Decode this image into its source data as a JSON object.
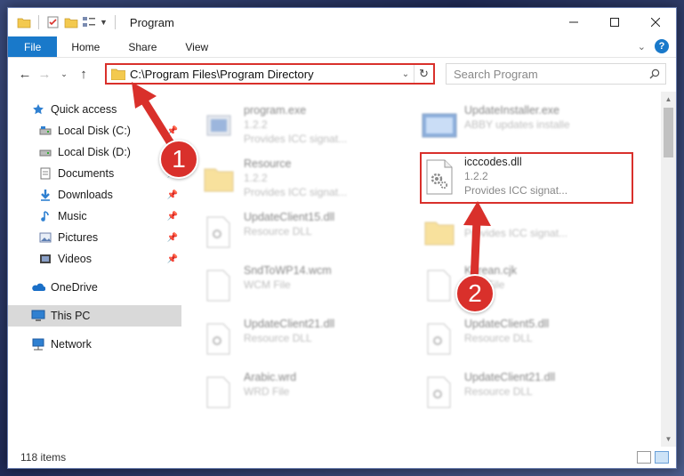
{
  "window": {
    "title": "Program",
    "controls": [
      "minimize",
      "maximize",
      "close"
    ]
  },
  "ribbon": {
    "tabs": [
      "File",
      "Home",
      "Share",
      "View"
    ],
    "help": "?"
  },
  "nav": {
    "address": "C:\\Program Files\\Program Directory",
    "search_placeholder": "Search Program"
  },
  "sidebar": {
    "items": [
      {
        "label": "Quick access",
        "icon": "star-icon"
      },
      {
        "label": "Local Disk (C:)",
        "icon": "drive-icon"
      },
      {
        "label": "Local Disk (D:)",
        "icon": "drive-icon"
      },
      {
        "label": "Documents",
        "icon": "documents-icon"
      },
      {
        "label": "Downloads",
        "icon": "downloads-icon"
      },
      {
        "label": "Music",
        "icon": "music-icon"
      },
      {
        "label": "Pictures",
        "icon": "pictures-icon"
      },
      {
        "label": "Videos",
        "icon": "videos-icon"
      },
      {
        "label": "OneDrive",
        "icon": "cloud-icon"
      },
      {
        "label": "This PC",
        "icon": "computer-icon"
      },
      {
        "label": "Network",
        "icon": "network-icon"
      }
    ]
  },
  "files": [
    {
      "name": "program.exe",
      "line2": "1.2.2",
      "line3": "Provides ICC signat..."
    },
    {
      "name": "UpdateInstaller.exe",
      "line2": "ABBY updates installe",
      "line3": ""
    },
    {
      "name": "Resource",
      "line2": "1.2.2",
      "line3": "Provides ICC signat..."
    },
    {
      "name": "icccodes.dll",
      "line2": "1.2.2",
      "line3": "Provides ICC signat..."
    },
    {
      "name": "UpdateClient15.dll",
      "line2": "Resource DLL",
      "line3": ""
    },
    {
      "name": "",
      "line2": "Provides ICC signat...",
      "line3": ""
    },
    {
      "name": "SndToWP14.wcm",
      "line2": "WCM File",
      "line3": ""
    },
    {
      "name": "Korean.cjk",
      "line2": "CJK File",
      "line3": ""
    },
    {
      "name": "UpdateClient21.dll",
      "line2": "Resource DLL",
      "line3": ""
    },
    {
      "name": "UpdateClient5.dll",
      "line2": "Resource DLL",
      "line3": ""
    },
    {
      "name": "Arabic.wrd",
      "line2": "WRD File",
      "line3": ""
    },
    {
      "name": "UpdateClient21.dll",
      "line2": "Resource DLL",
      "line3": ""
    }
  ],
  "status": {
    "items": "118 items"
  },
  "annotations": {
    "step1": "1",
    "step2": "2",
    "color": "#d9302b"
  }
}
